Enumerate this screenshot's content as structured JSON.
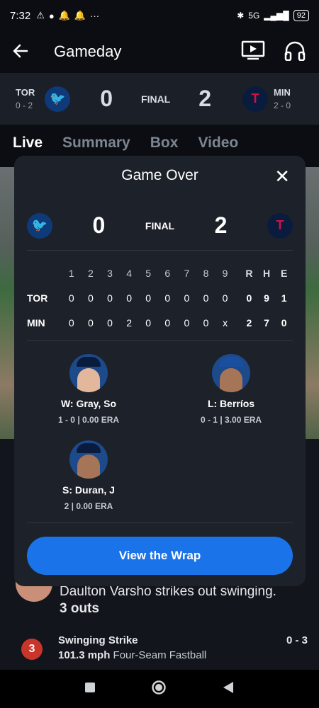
{
  "status_bar": {
    "time": "7:32",
    "battery": "92",
    "network": "5G"
  },
  "header": {
    "title": "Gameday",
    "back_icon": "arrow-left-icon",
    "cast_icon": "tv-play-icon",
    "audio_icon": "headphones-icon"
  },
  "strip": {
    "away": {
      "abbr": "TOR",
      "record": "0 - 2",
      "score": "0"
    },
    "status": "FINAL",
    "home": {
      "abbr": "MIN",
      "record": "2 - 0",
      "score": "2"
    }
  },
  "tabs": [
    "Live",
    "Summary",
    "Box",
    "Video"
  ],
  "modal": {
    "title": "Game Over",
    "away_score": "0",
    "status": "FINAL",
    "home_score": "2",
    "innings": [
      "1",
      "2",
      "3",
      "4",
      "5",
      "6",
      "7",
      "8",
      "9"
    ],
    "rhe_labels": [
      "R",
      "H",
      "E"
    ],
    "rows": [
      {
        "team": "TOR",
        "innings": [
          "0",
          "0",
          "0",
          "0",
          "0",
          "0",
          "0",
          "0",
          "0"
        ],
        "rhe": [
          "0",
          "9",
          "1"
        ]
      },
      {
        "team": "MIN",
        "innings": [
          "0",
          "0",
          "0",
          "2",
          "0",
          "0",
          "0",
          "0",
          "x"
        ],
        "rhe": [
          "2",
          "7",
          "0"
        ]
      }
    ],
    "winner": {
      "name": "W: Gray, So",
      "stat": "1 - 0  |  0.00 ERA"
    },
    "loser": {
      "name": "L: Berríos",
      "stat": "0 - 1  |  3.00 ERA"
    },
    "save": {
      "name": "S: Duran, J",
      "stat": "2  |  0.00 ERA"
    },
    "button": "View the Wrap"
  },
  "feed": {
    "play_text": "Daulton Varsho strikes out swinging.",
    "outs": "3 outs",
    "pitch_number": "3",
    "pitch_type": "Swinging Strike",
    "pitch_speed": "101.3 mph",
    "pitch_name": "Four-Seam Fastball",
    "count": "0 - 3"
  }
}
